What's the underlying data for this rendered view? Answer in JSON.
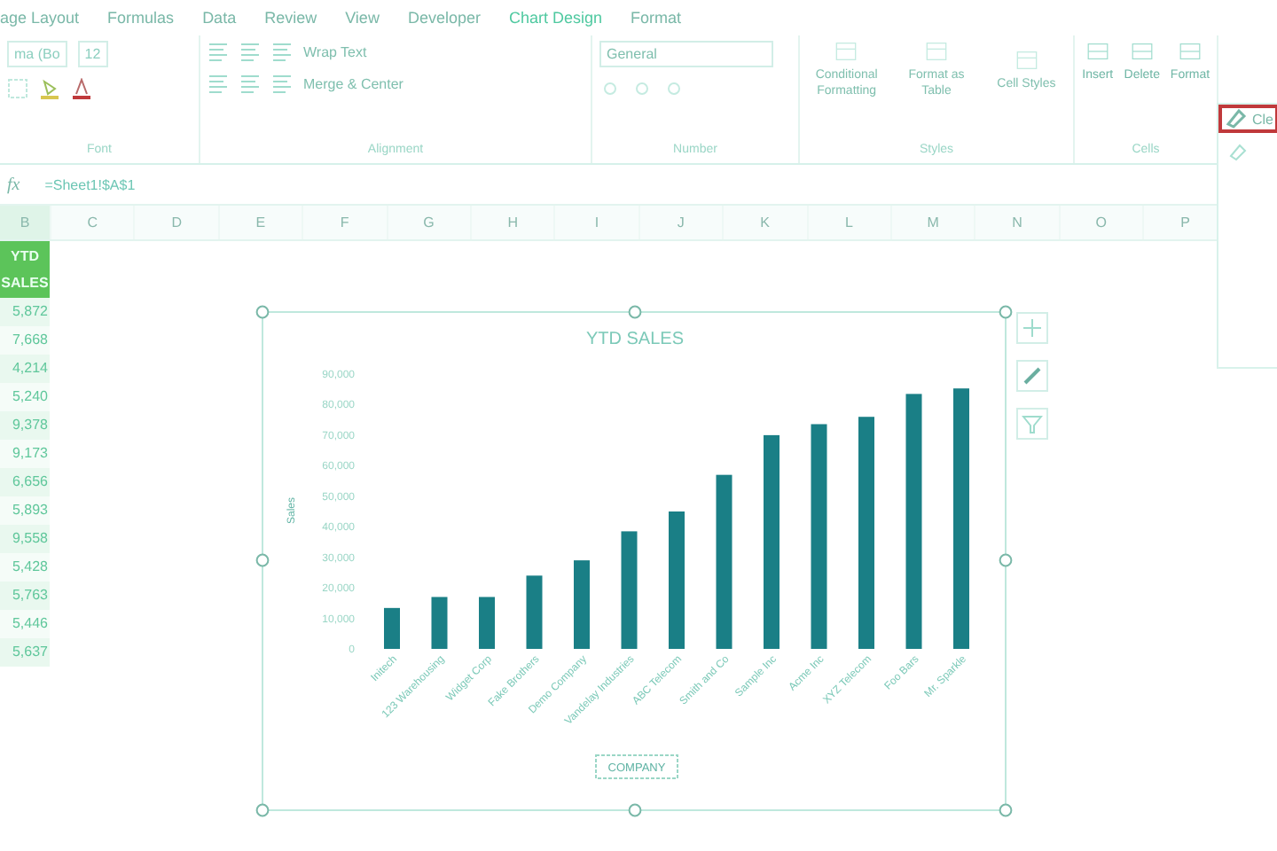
{
  "ribbon": {
    "tabs": [
      {
        "label": "age Layout",
        "selected": false
      },
      {
        "label": "Formulas",
        "selected": false
      },
      {
        "label": "Data",
        "selected": false
      },
      {
        "label": "Review",
        "selected": false
      },
      {
        "label": "View",
        "selected": false
      },
      {
        "label": "Developer",
        "selected": false
      },
      {
        "label": "Chart Design",
        "selected": true
      },
      {
        "label": "Format",
        "selected": false
      }
    ],
    "font_box": "ma (Bo",
    "size_box": "12",
    "wrap_text": "Wrap Text",
    "merge_center": "Merge & Center",
    "number_format": "General",
    "style_buttons": [
      "Conditional Formatting",
      "Format as Table",
      "Cell Styles"
    ],
    "cell_buttons": [
      "Insert",
      "Delete",
      "Format"
    ],
    "groups": [
      "Font",
      "Alignment",
      "Number",
      "Styles",
      "Cells"
    ]
  },
  "side_menu": {
    "items": [
      {
        "label": "Cle",
        "selected": true
      }
    ]
  },
  "formula_bar": {
    "fx": "fx",
    "formula": "=Sheet1!$A$1"
  },
  "sheet": {
    "columns": [
      "B",
      "C",
      "D",
      "E",
      "F",
      "G",
      "H",
      "I",
      "J",
      "K",
      "L",
      "M",
      "N",
      "O",
      "P"
    ],
    "header": "YTD SALES",
    "values": [
      "5,872",
      "7,668",
      "4,214",
      "5,240",
      "9,378",
      "9,173",
      "6,656",
      "5,893",
      "9,558",
      "5,428",
      "5,763",
      "5,446",
      "5,637"
    ]
  },
  "chart": {
    "chart_data": {
      "type": "bar",
      "title": "YTD SALES",
      "xlabel": "COMPANY",
      "ylabel": "Sales",
      "categories": [
        "Initech",
        "123 Warehousing",
        "Widget Corp",
        "Fake Brothers",
        "Demo Company",
        "Vandelay Industries",
        "ABC Telecom",
        "Smith and Co",
        "Sample Inc",
        "Acme Inc",
        "XYZ Telecom",
        "Foo Bars",
        "Mr. Sparkle"
      ],
      "series": [
        {
          "color": "#1a7f86",
          "values": [
            13400,
            17000,
            17000,
            24000,
            29000,
            38500,
            45000,
            57000,
            70000,
            73600,
            76000,
            83500,
            85300
          ]
        }
      ],
      "ylim": [
        0,
        90000
      ],
      "yticks": [
        {
          "value": 0,
          "label": "0"
        },
        {
          "value": 10000,
          "label": "10,000"
        },
        {
          "value": 20000,
          "label": "20,000"
        },
        {
          "value": 30000,
          "label": "30,000"
        },
        {
          "value": 40000,
          "label": "40,000"
        },
        {
          "value": 50000,
          "label": "50,000"
        },
        {
          "value": 60000,
          "label": "60,000"
        },
        {
          "value": 70000,
          "label": "70,000"
        },
        {
          "value": 80000,
          "label": "80,000"
        },
        {
          "value": 90000,
          "label": "90,000"
        }
      ]
    }
  }
}
